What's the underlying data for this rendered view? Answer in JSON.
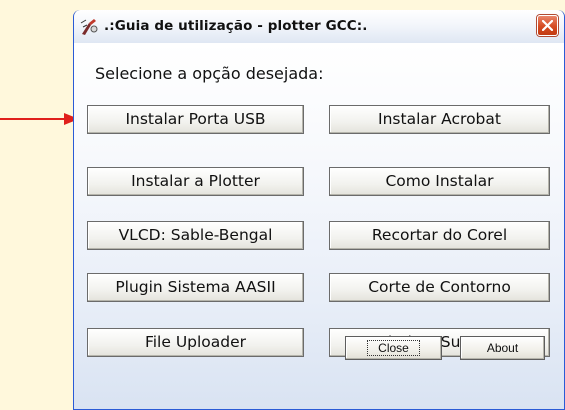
{
  "window": {
    "title": ".:Guia de utilização - plotter GCC:.",
    "icon": "plotter-app-icon",
    "close_icon": "close-icon"
  },
  "prompt": "Selecione a opção desejada:",
  "buttons": {
    "left": [
      "Instalar Porta USB",
      "Instalar a Plotter",
      "VLCD: Sable-Bengal",
      "Plugin Sistema AASII",
      "File Uploader"
    ],
    "right": [
      "Instalar Acrobat",
      "Como Instalar",
      "Recortar do Corel",
      "Corte de Contorno",
      "Ajuda e Suporte"
    ]
  },
  "footer": {
    "close_label": "Close",
    "about_label": "About"
  },
  "colors": {
    "arrow": "#e0201b",
    "titlebar_border": "#2a5bd6",
    "close_button": "#d54b22"
  }
}
